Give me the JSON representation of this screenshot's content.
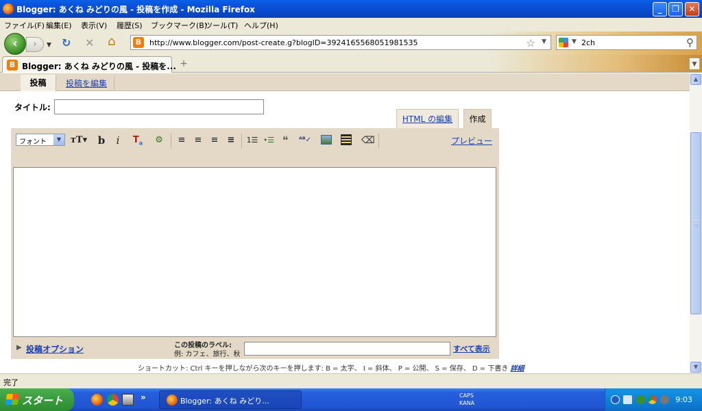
{
  "window": {
    "title": "Blogger: あくね みどりの風 - 投稿を作成 - Mozilla Firefox",
    "btn_minimize": "_",
    "btn_maximize": "❐",
    "btn_close": "✕"
  },
  "menu": [
    "ファイル(F)",
    "編集(E)",
    "表示(V)",
    "履歴(S)",
    "ブックマーク(B)",
    "ツール(T)",
    "ヘルプ(H)"
  ],
  "nav": {
    "back": "‹",
    "forward": "›",
    "reload": "↻",
    "stop": "✕",
    "home": "⌂",
    "url": "http://www.blogger.com/post-create.g?blogID=3924165568051981535",
    "search_value": "2ch"
  },
  "tabs": {
    "active_title": "Blogger: あくね みどりの風 - 投稿を...",
    "new_tab": "+"
  },
  "blogger": {
    "subnav_active": "投稿",
    "subnav_edit": "投稿を編集",
    "title_label": "タイトル:",
    "tab_html": "HTML の編集",
    "tab_compose": "作成",
    "font_select": "フォント",
    "btn_bold": "b",
    "btn_italic": "i",
    "preview": "プレビュー",
    "post_options": "投稿オプション",
    "label_heading": "この投稿のラベル:",
    "label_example": "例: カフェ、旅行、秋",
    "show_all": "すべて表示",
    "shortcut_text": "ショートカット: Ctrl キーを押しながら次のキーを押します: B = 太字、 I = 斜体、 P = 公開、 S = 保存、 D = 下書き",
    "shortcut_detail": "詳細"
  },
  "status": "完了",
  "taskbar": {
    "start": "スタート",
    "task_item": "Blogger: あくね みどり...",
    "ime_top": "CAPS",
    "ime_bottom": "KANA",
    "clock": "9:03"
  },
  "colors": {
    "accent_link": "#1a3fb0",
    "editor_bg": "#e3d9c6",
    "titlebar": "#0a4fd6"
  }
}
